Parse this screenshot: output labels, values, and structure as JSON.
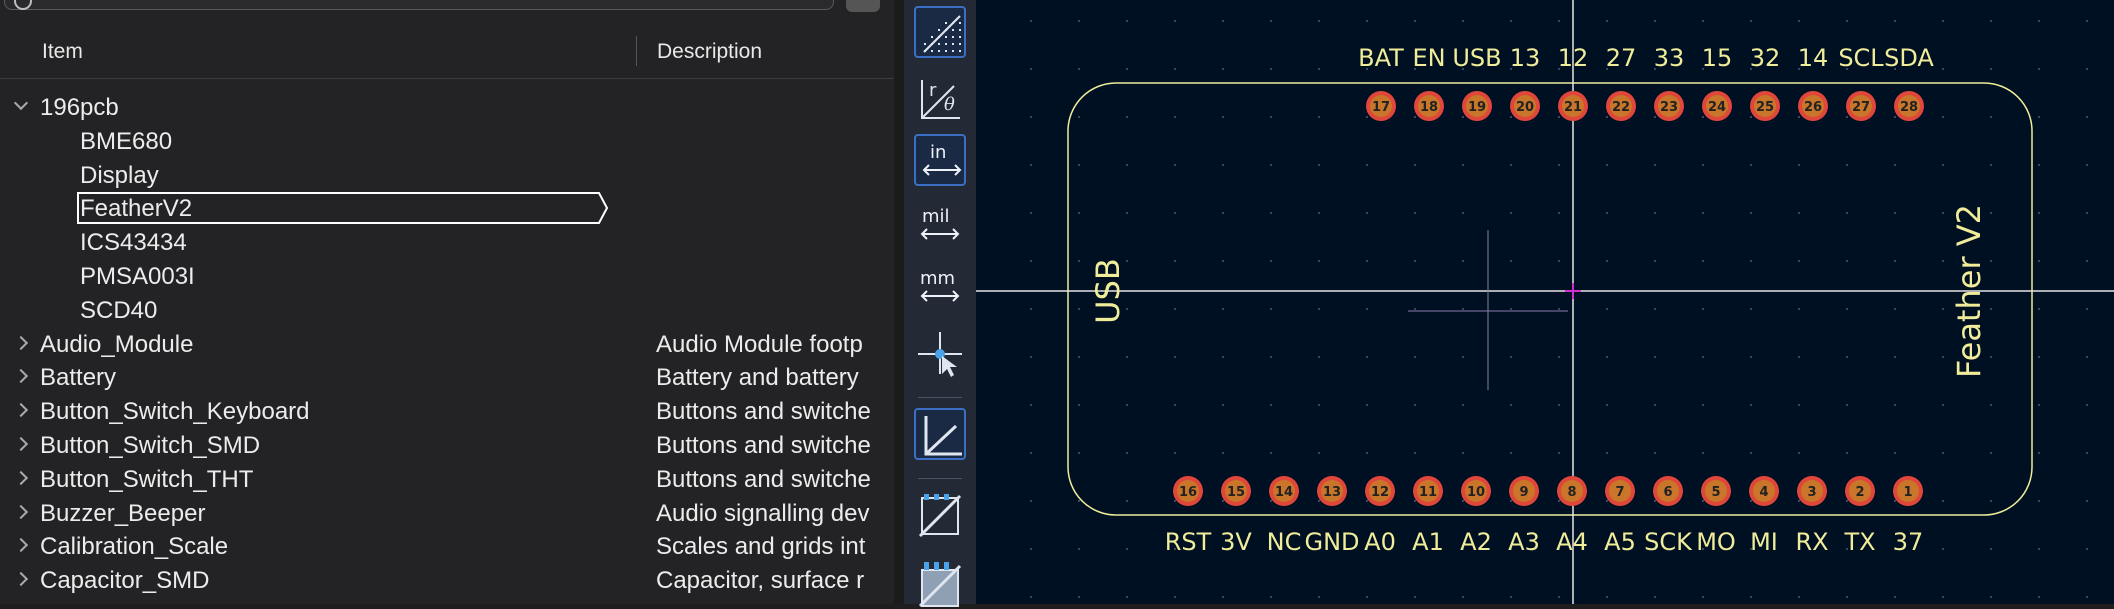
{
  "library": {
    "columns": {
      "item": "Item",
      "description": "Description"
    },
    "rows": [
      {
        "label": "196pcb",
        "desc": "",
        "level": 0,
        "expanded": true
      },
      {
        "label": "BME680",
        "desc": "",
        "level": 1
      },
      {
        "label": "Display",
        "desc": "",
        "level": 1
      },
      {
        "label": "FeatherV2",
        "desc": "",
        "level": 1,
        "selected": true
      },
      {
        "label": "ICS43434",
        "desc": "",
        "level": 1
      },
      {
        "label": "PMSA003I",
        "desc": "",
        "level": 1
      },
      {
        "label": "SCD40",
        "desc": "",
        "level": 1
      },
      {
        "label": "Audio_Module",
        "desc": "Audio Module footp",
        "level": 0,
        "expanded": false
      },
      {
        "label": "Battery",
        "desc": "Battery and battery",
        "level": 0,
        "expanded": false
      },
      {
        "label": "Button_Switch_Keyboard",
        "desc": "Buttons and switche",
        "level": 0,
        "expanded": false
      },
      {
        "label": "Button_Switch_SMD",
        "desc": "Buttons and switche",
        "level": 0,
        "expanded": false
      },
      {
        "label": "Button_Switch_THT",
        "desc": "Buttons and switche",
        "level": 0,
        "expanded": false
      },
      {
        "label": "Buzzer_Beeper",
        "desc": "Audio signalling dev",
        "level": 0,
        "expanded": false
      },
      {
        "label": "Calibration_Scale",
        "desc": "Scales and grids int",
        "level": 0,
        "expanded": false
      },
      {
        "label": "Capacitor_SMD",
        "desc": "Capacitor, surface r",
        "level": 0,
        "expanded": false
      }
    ]
  },
  "toolbar": {
    "buttons": [
      {
        "name": "grid-toggle",
        "icon": "grid-icon",
        "active": true
      },
      {
        "name": "polar-coords",
        "icon": "polar-coordinates-icon",
        "text": "r θ",
        "active": false
      },
      {
        "name": "units-inches",
        "icon": "inches-icon",
        "text": "in",
        "active": true
      },
      {
        "name": "units-mils",
        "icon": "mils-icon",
        "text": "mil",
        "active": false
      },
      {
        "name": "units-mm",
        "icon": "millimeters-icon",
        "text": "mm",
        "active": false
      },
      {
        "name": "cursor-style",
        "icon": "crosshair-cursor-icon",
        "active": false
      },
      {
        "name": "local-origin",
        "icon": "axes-origin-icon",
        "active": true
      },
      {
        "name": "pad-display",
        "icon": "pad-outline-icon",
        "active": false
      },
      {
        "name": "via-display",
        "icon": "via-outline-icon",
        "active": false
      }
    ]
  },
  "footprint": {
    "name": "Feather V2",
    "usb_label": "USB",
    "top_pins": [
      {
        "num": "17",
        "label": "BAT"
      },
      {
        "num": "18",
        "label": "EN"
      },
      {
        "num": "19",
        "label": "USB"
      },
      {
        "num": "20",
        "label": "13"
      },
      {
        "num": "21",
        "label": "12"
      },
      {
        "num": "22",
        "label": "27"
      },
      {
        "num": "23",
        "label": "33"
      },
      {
        "num": "24",
        "label": "15"
      },
      {
        "num": "25",
        "label": "32"
      },
      {
        "num": "26",
        "label": "14"
      },
      {
        "num": "27",
        "label": "SCL"
      },
      {
        "num": "28",
        "label": "SDA"
      }
    ],
    "bottom_pins": [
      {
        "num": "16",
        "label": "RST"
      },
      {
        "num": "15",
        "label": "3V"
      },
      {
        "num": "14",
        "label": "NC"
      },
      {
        "num": "13",
        "label": "GND"
      },
      {
        "num": "12",
        "label": "A0"
      },
      {
        "num": "11",
        "label": "A1"
      },
      {
        "num": "10",
        "label": "A2"
      },
      {
        "num": "9",
        "label": "A3"
      },
      {
        "num": "8",
        "label": "A4"
      },
      {
        "num": "7",
        "label": "A5"
      },
      {
        "num": "6",
        "label": "SCK"
      },
      {
        "num": "5",
        "label": "MO"
      },
      {
        "num": "4",
        "label": "MI"
      },
      {
        "num": "3",
        "label": "RX"
      },
      {
        "num": "2",
        "label": "TX"
      },
      {
        "num": "1",
        "label": "37"
      }
    ],
    "colors": {
      "silk": "#f0ec9a",
      "pad": "#c9762a",
      "pad_ring": "#e0463a",
      "background": "#001023"
    }
  }
}
